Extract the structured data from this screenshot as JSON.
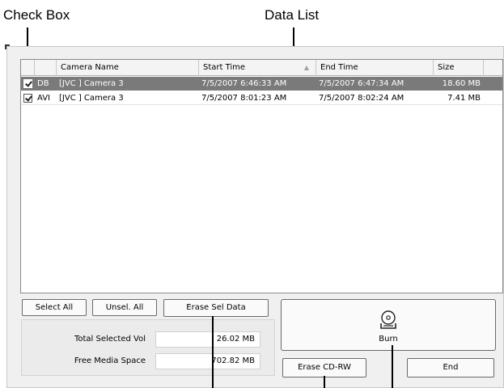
{
  "callouts": {
    "check_box": "Check Box",
    "data_list": "Data List"
  },
  "list": {
    "columns": [
      "",
      "",
      "Camera Name",
      "Start Time",
      "End Time",
      "Size"
    ],
    "rows": [
      {
        "checked": true,
        "selected": true,
        "type": "DB",
        "camera": "[JVC ] Camera 3",
        "start": "7/5/2007 6:46:33 AM",
        "end": "7/5/2007 6:47:34 AM",
        "size": "18.60 MB"
      },
      {
        "checked": true,
        "selected": false,
        "type": "AVI",
        "camera": "[JVC ] Camera 3",
        "start": "7/5/2007 8:01:23 AM",
        "end": "7/5/2007 8:02:24 AM",
        "size": "7.41 MB"
      }
    ]
  },
  "buttons": {
    "select_all": "Select All",
    "unsel_all": "Unsel. All",
    "erase_sel_data": "Erase Sel Data",
    "burn": "Burn",
    "erase_cdrw": "Erase CD-RW",
    "end": "End"
  },
  "info": {
    "total_selected_label": "Total Selected Vol",
    "total_selected_value": "26.02 MB",
    "free_space_label": "Free Media Space",
    "free_space_value": "702.82 MB"
  },
  "colors": {
    "selected_row": "#7a7a7a",
    "window_bg": "#f0f0f0"
  },
  "icons": {
    "burn": "disc-burn-icon",
    "checkbox": "checkmark-icon",
    "sort": "sort-ascending-icon"
  }
}
